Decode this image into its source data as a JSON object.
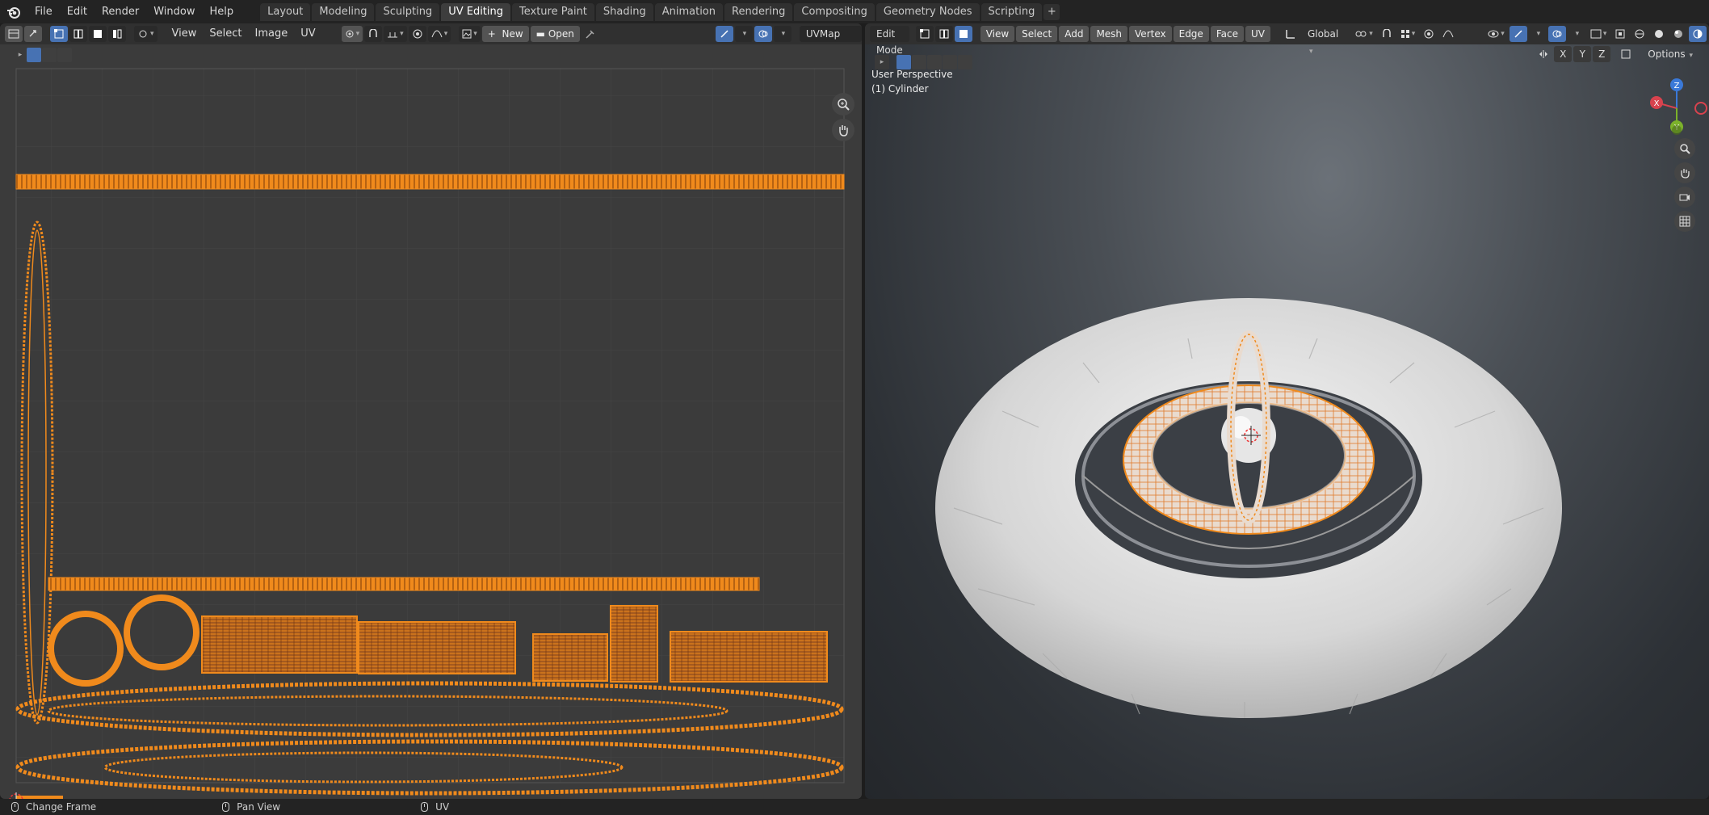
{
  "topbar": {
    "menus": [
      "File",
      "Edit",
      "Render",
      "Window",
      "Help"
    ],
    "workspaces": [
      "Layout",
      "Modeling",
      "Sculpting",
      "UV Editing",
      "Texture Paint",
      "Shading",
      "Animation",
      "Rendering",
      "Compositing",
      "Geometry Nodes",
      "Scripting"
    ],
    "active_workspace": "UV Editing",
    "add_tab": "+"
  },
  "uv_editor": {
    "menus": [
      "View",
      "Select",
      "Image",
      "UV"
    ],
    "new_label": "New",
    "open_label": "Open",
    "uvmap_name": "UVMap"
  },
  "viewport": {
    "mode": "Edit Mode",
    "menus": [
      "View",
      "Select",
      "Add",
      "Mesh",
      "Vertex",
      "Edge",
      "Face",
      "UV"
    ],
    "transform_orientation": "Global",
    "perspective_label": "User Perspective",
    "object_label": "(1) Cylinder",
    "axis_x": "X",
    "axis_y": "Y",
    "axis_z": "Z",
    "options_label": "Options",
    "gizmo_labels": [
      "X",
      "Y",
      "Z"
    ]
  },
  "statusbar": {
    "items": [
      "Change Frame",
      "Pan View",
      "UV"
    ]
  },
  "colors": {
    "accent": "#4772b3",
    "uv_orange": "#f08a1c",
    "mesh_white": "#d8d8d8"
  }
}
